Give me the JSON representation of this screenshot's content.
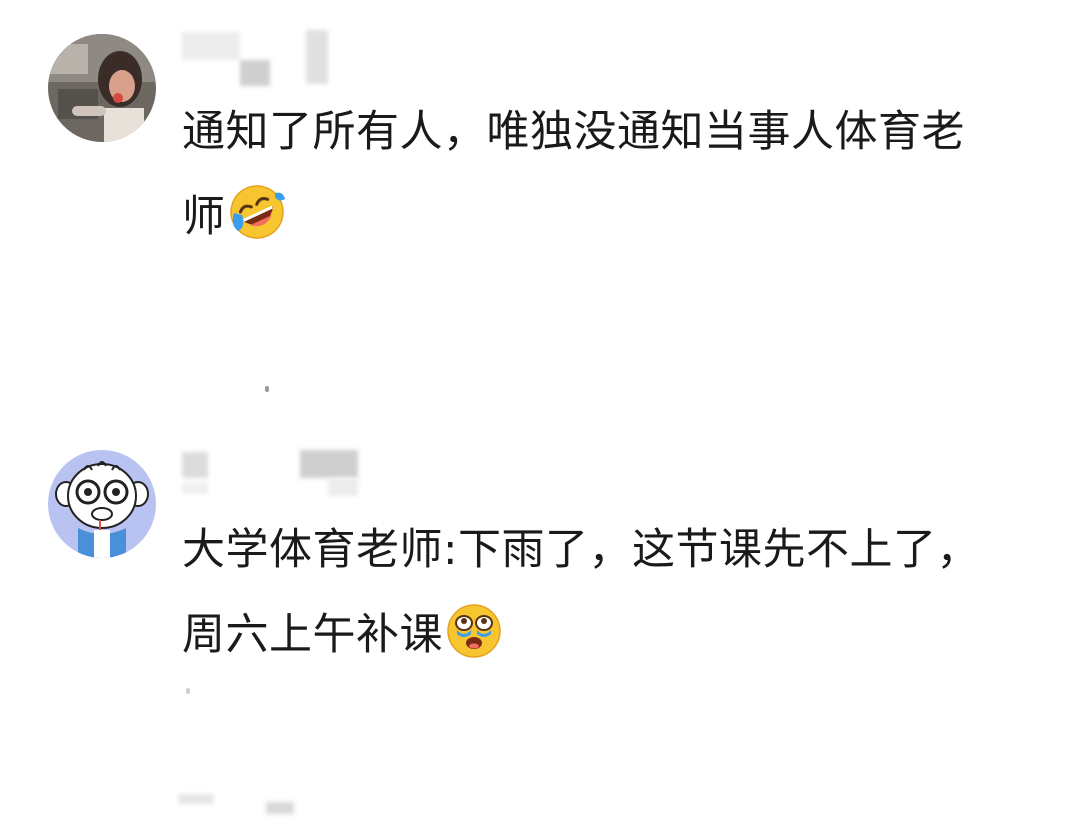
{
  "comments": [
    {
      "text_line1": "通知了所有人，唯独没通知当事人体育老",
      "text_line2": "师",
      "emoji_icon": "rolling-on-floor-laughing-icon"
    },
    {
      "text_line1": "大学体育老师:下雨了，这节课先不上了，",
      "text_line2": "周六上午补课",
      "emoji_icon": "loudly-crying-face-icon"
    }
  ],
  "colors": {
    "background": "#ffffff",
    "text": "#1a1a1a",
    "emoji_yellow": "#f7c530",
    "tear_blue": "#3b9ded",
    "avatar2_bg": "#b9c3f2"
  }
}
